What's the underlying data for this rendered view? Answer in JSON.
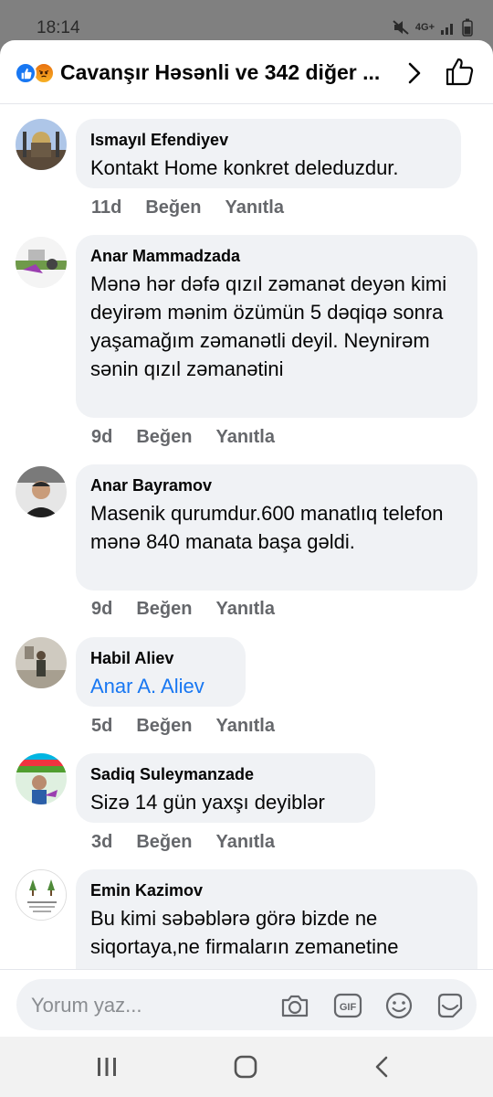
{
  "status_bar": {
    "time": "18:14",
    "network": "4G+"
  },
  "header": {
    "title": "Cavanşır Həsənli ve 342 diğer ..."
  },
  "comments": [
    {
      "author": "Ismayıl Efendiyev",
      "text": "Kontakt Home konkret deleduzdur.",
      "time": "11d",
      "like": "Beğen",
      "reply": "Yanıtla"
    },
    {
      "author": "Anar Mammadzada",
      "text": "Mənə hər dəfə qızıl zəmanət deyən kimi deyirəm mənim özümün 5 dəqiqə sonra yaşamağım zəmanətli deyil. Neynirəm sənin qızıl zəmanətini",
      "time": "9d",
      "like": "Beğen",
      "reply": "Yanıtla"
    },
    {
      "author": "Anar Bayramov",
      "text": "Masenik qurumdur.600 manatlıq telefon mənə 840 manata başa gəldi.",
      "time": "9d",
      "like": "Beğen",
      "reply": "Yanıtla"
    },
    {
      "author": "Habil Aliev",
      "text": "Anar A. Aliev",
      "time": "5d",
      "like": "Beğen",
      "reply": "Yanıtla"
    },
    {
      "author": "Sadiq Suleymanzade",
      "text": "Sizə 14 gün yaxşı deyiblər",
      "time": "3d",
      "like": "Beğen",
      "reply": "Yanıtla"
    },
    {
      "author": "Emin Kazimov",
      "text": "Bu  kimi səbəblərə görə bizde ne siqortaya,ne firmaların zemanetine"
    }
  ],
  "composer": {
    "placeholder": "Yorum yaz..."
  },
  "colors": {
    "accent": "#1877f2",
    "bubble": "#f0f2f5",
    "meta": "#65676b"
  }
}
